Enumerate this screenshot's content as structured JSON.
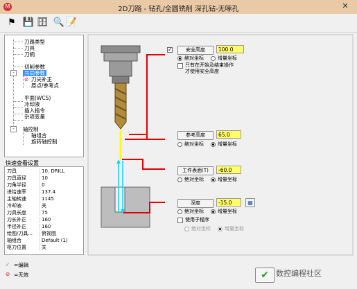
{
  "window": {
    "title": "2D刀路 - 钻孔/全圆铣削 深孔钻-无啄孔",
    "close_glyph": "✕",
    "logo_glyph": "M"
  },
  "toolbar": {
    "icons": [
      "tool-icon",
      "save-icon",
      "save-as-icon",
      "load-icon",
      "edit-icon"
    ],
    "glyphs": [
      "⚑",
      "💾",
      "🗄",
      "🔍",
      "📝"
    ]
  },
  "tree": {
    "items": [
      {
        "label": "刀路类型"
      },
      {
        "label": "刀具"
      },
      {
        "label": "刀柄"
      },
      {
        "label": "切削参数"
      },
      {
        "label": "共同参数"
      },
      {
        "label": "刀尖补正"
      },
      {
        "label": "原点/参考点"
      },
      {
        "label": "平面(WCS)"
      },
      {
        "label": "冷却液"
      },
      {
        "label": "插入指令"
      },
      {
        "label": "杂项变量"
      },
      {
        "label": "轴控制"
      },
      {
        "label": "轴组合"
      },
      {
        "label": "旋转轴控制"
      }
    ]
  },
  "quick_view": {
    "title": "快速查看设置",
    "rows": [
      {
        "k": "刀具",
        "v": "10. DRILL"
      },
      {
        "k": "刀具直径",
        "v": "10"
      },
      {
        "k": "刀角半径",
        "v": "0"
      },
      {
        "k": "进给速率",
        "v": "137.4"
      },
      {
        "k": "主轴转速",
        "v": "1145"
      },
      {
        "k": "冷却液",
        "v": "关"
      },
      {
        "k": "刀具长度",
        "v": "75"
      },
      {
        "k": "刀长补正",
        "v": "160"
      },
      {
        "k": "半径补正",
        "v": "160"
      },
      {
        "k": "绘图/刀具...",
        "v": "俯视图"
      },
      {
        "k": "轴组合",
        "v": "Default (1)"
      },
      {
        "k": "枢刀位置",
        "v": "关"
      }
    ]
  },
  "status": {
    "edit_label": "=编辑",
    "invalid_label": "=无效",
    "edit_glyph": "✓",
    "invalid_glyph": "⊘"
  },
  "params": {
    "clearance": {
      "checked": true,
      "check_glyph": "✓",
      "button": "安全高度",
      "value": "100.0",
      "abs": "绝对坐标",
      "inc": "增量坐标",
      "only_start": "只有在开始及结束操作",
      "only_start2": "才使用安全高度"
    },
    "retract": {
      "button": "参考高度",
      "value": "65.0",
      "abs": "绝对坐标",
      "inc": "增量坐标"
    },
    "top": {
      "button": "工件表面(T)",
      "value": "-60.0",
      "abs": "绝对坐标",
      "inc": "增量坐标"
    },
    "depth": {
      "button": "深度",
      "value": "-15.0",
      "abs": "绝对坐标",
      "inc": "增量坐标",
      "calc_glyph": "▦"
    },
    "subprogram": {
      "label": "使用子程序",
      "abs": "绝对坐标",
      "inc": "增量坐标"
    }
  },
  "ok": {
    "glyph": "✔"
  },
  "watermark": {
    "text": "数控编程社区"
  },
  "colors": {
    "highlight": "#ffff66",
    "select": "#3390ff",
    "red": "#e00000",
    "cyan": "#00d8ff",
    "yellow": "#ffff00",
    "block": "#bdbdbd"
  }
}
